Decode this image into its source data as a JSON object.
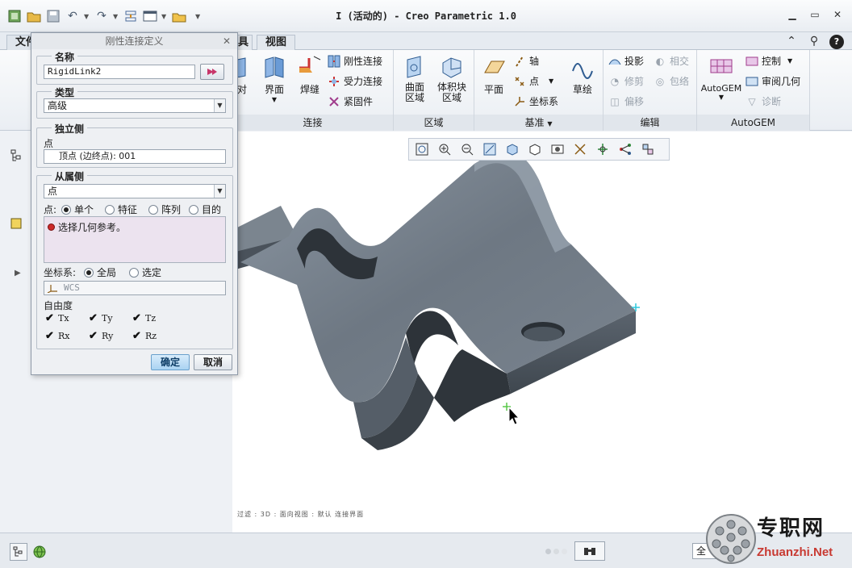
{
  "window": {
    "title": "I (活动的) - Creo Parametric 1.0"
  },
  "ribbon": {
    "file_tab": "文件",
    "tabs": [
      "具",
      "视图"
    ],
    "groups": {
      "connect": {
        "label": "连接",
        "items": {
          "interface": "界面",
          "weld": "焊缝",
          "rigid": "刚性连接",
          "force": "受力连接",
          "fastener": "紧固件",
          "partial": "对"
        }
      },
      "region": {
        "label": "区域",
        "items": {
          "surface_region": "曲面\n区域",
          "volume_block": "体积块\n区域"
        }
      },
      "datum": {
        "label": "基准",
        "items": {
          "plane": "平面",
          "axis": "轴",
          "point": "点",
          "csys": "坐标系",
          "sketch": "草绘"
        }
      },
      "edit": {
        "label": "编辑",
        "items": {
          "project": "投影",
          "intersect": "相交",
          "trim": "修剪",
          "wrap": "包络",
          "offset": "偏移"
        }
      },
      "autogem": {
        "label": "AutoGEM",
        "items": {
          "autogem": "AutoGEM",
          "control": "控制",
          "review": "审阅几何",
          "diagnose": "诊断"
        }
      }
    }
  },
  "dialog": {
    "title": "刚性连接定义",
    "name_label": "名称",
    "name_value": "RigidLink2",
    "type_label": "类型",
    "type_value": "高级",
    "independent_label": "独立侧",
    "independent_point_label": "点",
    "independent_point_value": "顶点 (边终点): 001",
    "dependent_label": "从属侧",
    "dependent_type_value": "点",
    "point_label": "点:",
    "point_options": [
      "单个",
      "特征",
      "阵列",
      "目的"
    ],
    "message": "选择几何参考。",
    "csys_label": "坐标系:",
    "csys_options": [
      "全局",
      "选定"
    ],
    "csys_field": "WCS",
    "dof_label": "自由度",
    "dof": [
      "Tx",
      "Ty",
      "Tz",
      "Rx",
      "Ry",
      "Rz"
    ],
    "ok": "确定",
    "cancel": "取消"
  },
  "viewport": {
    "status_text": "过滤 : 3D : 面向视图 : 默认 连接界面"
  },
  "watermark": {
    "cn": "专职网",
    "en": "Zhuanzhi.Net"
  },
  "statusbar": {
    "filter_value": "全"
  }
}
